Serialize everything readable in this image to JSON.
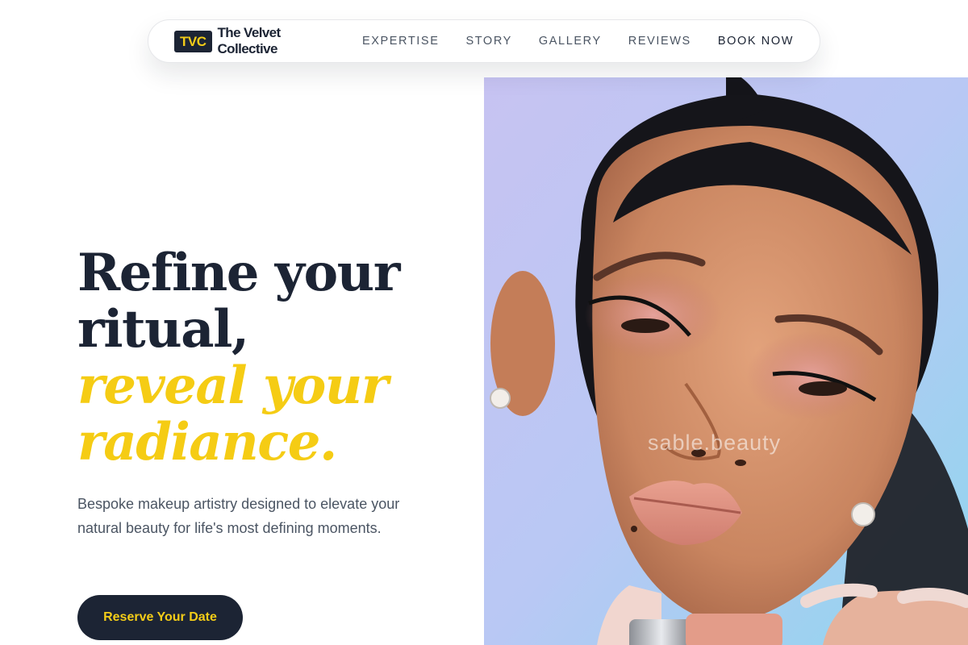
{
  "brand": {
    "badge": "TVC",
    "name": "The Velvet Collective",
    "badge_color": "#1c2434",
    "accent_color": "#f3cc18"
  },
  "nav": {
    "items": [
      {
        "label": "EXPERTISE"
      },
      {
        "label": "STORY"
      },
      {
        "label": "GALLERY"
      },
      {
        "label": "REVIEWS"
      }
    ],
    "cta_label": "BOOK NOW"
  },
  "hero": {
    "headline_line1": "Refine your",
    "headline_line2": "ritual,",
    "headline_accent_line1": "reveal your",
    "headline_accent_line2": "radiance.",
    "description": "Bespoke makeup artistry designed to elevate your natural beauty for life's most defining moments.",
    "button_label": "Reserve Your Date"
  },
  "photo": {
    "watermark": "sable.beauty",
    "subject": "portrait-of-woman-with-pink-eyeshadow-holding-lipgloss"
  }
}
